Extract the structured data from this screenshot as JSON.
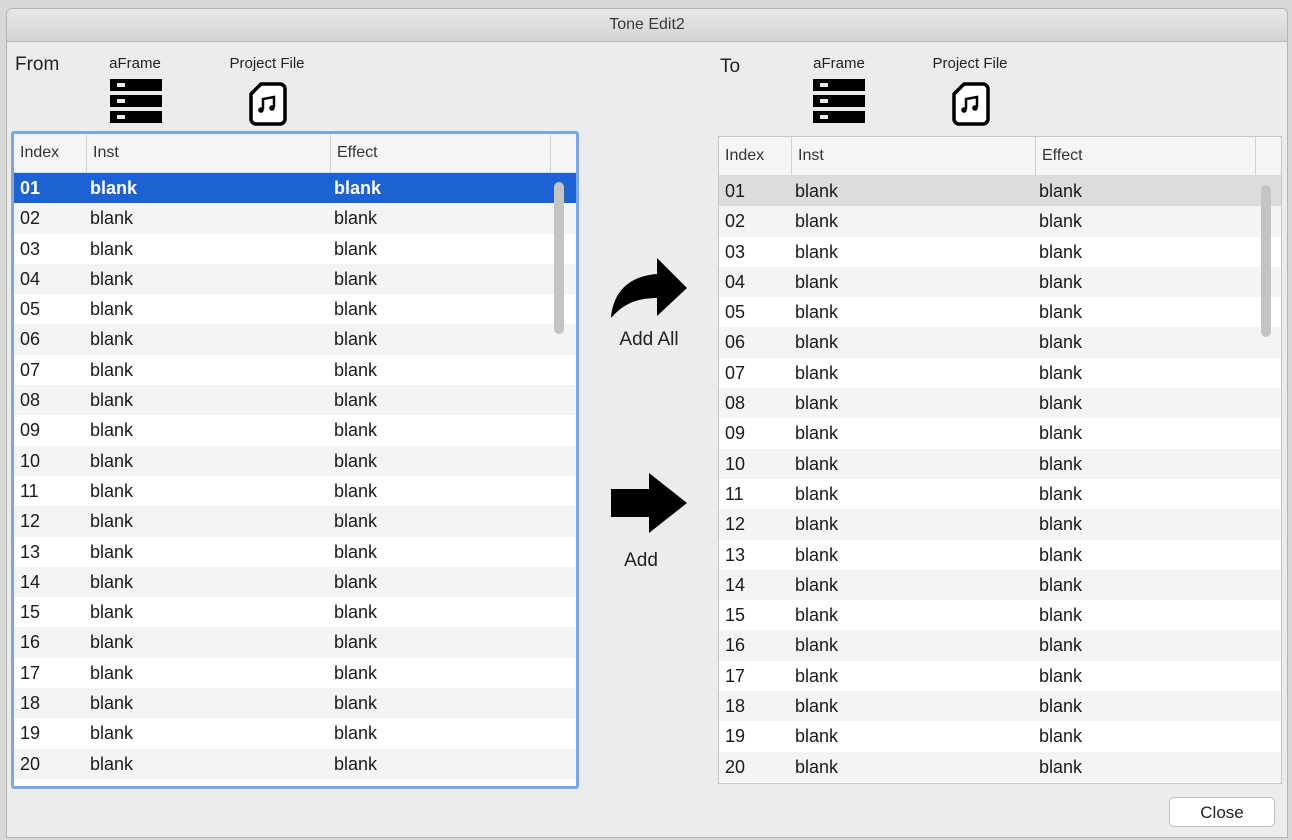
{
  "window": {
    "title": "Tone Edit2"
  },
  "from": {
    "label": "From",
    "source_aframe": "aFrame",
    "source_project": "Project File",
    "columns": [
      "Index",
      "Inst",
      "Effect"
    ],
    "rows": [
      {
        "index": "01",
        "inst": "blank",
        "effect": "blank"
      },
      {
        "index": "02",
        "inst": "blank",
        "effect": "blank"
      },
      {
        "index": "03",
        "inst": "blank",
        "effect": "blank"
      },
      {
        "index": "04",
        "inst": "blank",
        "effect": "blank"
      },
      {
        "index": "05",
        "inst": "blank",
        "effect": "blank"
      },
      {
        "index": "06",
        "inst": "blank",
        "effect": "blank"
      },
      {
        "index": "07",
        "inst": "blank",
        "effect": "blank"
      },
      {
        "index": "08",
        "inst": "blank",
        "effect": "blank"
      },
      {
        "index": "09",
        "inst": "blank",
        "effect": "blank"
      },
      {
        "index": "10",
        "inst": "blank",
        "effect": "blank"
      },
      {
        "index": "11",
        "inst": "blank",
        "effect": "blank"
      },
      {
        "index": "12",
        "inst": "blank",
        "effect": "blank"
      },
      {
        "index": "13",
        "inst": "blank",
        "effect": "blank"
      },
      {
        "index": "14",
        "inst": "blank",
        "effect": "blank"
      },
      {
        "index": "15",
        "inst": "blank",
        "effect": "blank"
      },
      {
        "index": "16",
        "inst": "blank",
        "effect": "blank"
      },
      {
        "index": "17",
        "inst": "blank",
        "effect": "blank"
      },
      {
        "index": "18",
        "inst": "blank",
        "effect": "blank"
      },
      {
        "index": "19",
        "inst": "blank",
        "effect": "blank"
      },
      {
        "index": "20",
        "inst": "blank",
        "effect": "blank"
      }
    ]
  },
  "to": {
    "label": "To",
    "source_aframe": "aFrame",
    "source_project": "Project File",
    "columns": [
      "Index",
      "Inst",
      "Effect"
    ],
    "rows": [
      {
        "index": "01",
        "inst": "blank",
        "effect": "blank"
      },
      {
        "index": "02",
        "inst": "blank",
        "effect": "blank"
      },
      {
        "index": "03",
        "inst": "blank",
        "effect": "blank"
      },
      {
        "index": "04",
        "inst": "blank",
        "effect": "blank"
      },
      {
        "index": "05",
        "inst": "blank",
        "effect": "blank"
      },
      {
        "index": "06",
        "inst": "blank",
        "effect": "blank"
      },
      {
        "index": "07",
        "inst": "blank",
        "effect": "blank"
      },
      {
        "index": "08",
        "inst": "blank",
        "effect": "blank"
      },
      {
        "index": "09",
        "inst": "blank",
        "effect": "blank"
      },
      {
        "index": "10",
        "inst": "blank",
        "effect": "blank"
      },
      {
        "index": "11",
        "inst": "blank",
        "effect": "blank"
      },
      {
        "index": "12",
        "inst": "blank",
        "effect": "blank"
      },
      {
        "index": "13",
        "inst": "blank",
        "effect": "blank"
      },
      {
        "index": "14",
        "inst": "blank",
        "effect": "blank"
      },
      {
        "index": "15",
        "inst": "blank",
        "effect": "blank"
      },
      {
        "index": "16",
        "inst": "blank",
        "effect": "blank"
      },
      {
        "index": "17",
        "inst": "blank",
        "effect": "blank"
      },
      {
        "index": "18",
        "inst": "blank",
        "effect": "blank"
      },
      {
        "index": "19",
        "inst": "blank",
        "effect": "blank"
      },
      {
        "index": "20",
        "inst": "blank",
        "effect": "blank"
      }
    ]
  },
  "actions": {
    "add_all": "Add All",
    "add": "Add"
  },
  "buttons": {
    "close": "Close"
  },
  "icons": {
    "aframe": "server-rack-icon",
    "project": "music-file-icon",
    "add_all": "curved-arrow-right-icon",
    "add": "arrow-right-icon"
  },
  "colors": {
    "selection": "#1c62d4",
    "focus_ring": "#7ba7ea",
    "inactive_selection": "#dcdcdc"
  }
}
